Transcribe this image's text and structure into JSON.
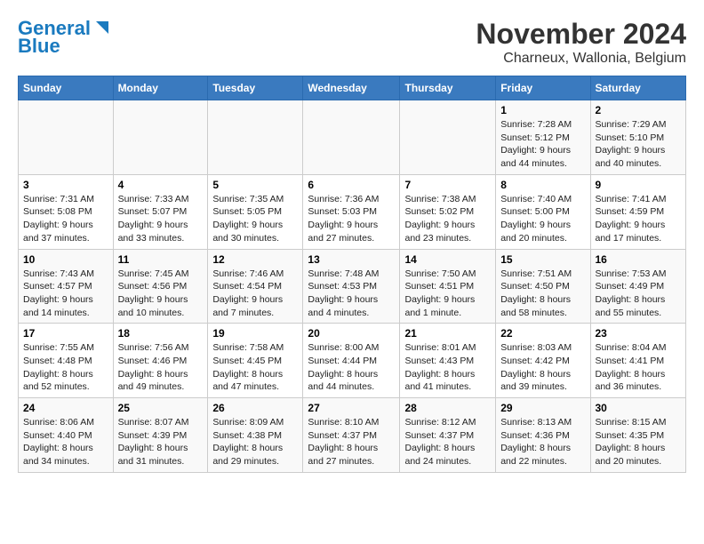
{
  "logo": {
    "line1": "General",
    "line2": "Blue"
  },
  "title": "November 2024",
  "subtitle": "Charneux, Wallonia, Belgium",
  "days_of_week": [
    "Sunday",
    "Monday",
    "Tuesday",
    "Wednesday",
    "Thursday",
    "Friday",
    "Saturday"
  ],
  "weeks": [
    [
      {
        "day": "",
        "detail": ""
      },
      {
        "day": "",
        "detail": ""
      },
      {
        "day": "",
        "detail": ""
      },
      {
        "day": "",
        "detail": ""
      },
      {
        "day": "",
        "detail": ""
      },
      {
        "day": "1",
        "detail": "Sunrise: 7:28 AM\nSunset: 5:12 PM\nDaylight: 9 hours and 44 minutes."
      },
      {
        "day": "2",
        "detail": "Sunrise: 7:29 AM\nSunset: 5:10 PM\nDaylight: 9 hours and 40 minutes."
      }
    ],
    [
      {
        "day": "3",
        "detail": "Sunrise: 7:31 AM\nSunset: 5:08 PM\nDaylight: 9 hours and 37 minutes."
      },
      {
        "day": "4",
        "detail": "Sunrise: 7:33 AM\nSunset: 5:07 PM\nDaylight: 9 hours and 33 minutes."
      },
      {
        "day": "5",
        "detail": "Sunrise: 7:35 AM\nSunset: 5:05 PM\nDaylight: 9 hours and 30 minutes."
      },
      {
        "day": "6",
        "detail": "Sunrise: 7:36 AM\nSunset: 5:03 PM\nDaylight: 9 hours and 27 minutes."
      },
      {
        "day": "7",
        "detail": "Sunrise: 7:38 AM\nSunset: 5:02 PM\nDaylight: 9 hours and 23 minutes."
      },
      {
        "day": "8",
        "detail": "Sunrise: 7:40 AM\nSunset: 5:00 PM\nDaylight: 9 hours and 20 minutes."
      },
      {
        "day": "9",
        "detail": "Sunrise: 7:41 AM\nSunset: 4:59 PM\nDaylight: 9 hours and 17 minutes."
      }
    ],
    [
      {
        "day": "10",
        "detail": "Sunrise: 7:43 AM\nSunset: 4:57 PM\nDaylight: 9 hours and 14 minutes."
      },
      {
        "day": "11",
        "detail": "Sunrise: 7:45 AM\nSunset: 4:56 PM\nDaylight: 9 hours and 10 minutes."
      },
      {
        "day": "12",
        "detail": "Sunrise: 7:46 AM\nSunset: 4:54 PM\nDaylight: 9 hours and 7 minutes."
      },
      {
        "day": "13",
        "detail": "Sunrise: 7:48 AM\nSunset: 4:53 PM\nDaylight: 9 hours and 4 minutes."
      },
      {
        "day": "14",
        "detail": "Sunrise: 7:50 AM\nSunset: 4:51 PM\nDaylight: 9 hours and 1 minute."
      },
      {
        "day": "15",
        "detail": "Sunrise: 7:51 AM\nSunset: 4:50 PM\nDaylight: 8 hours and 58 minutes."
      },
      {
        "day": "16",
        "detail": "Sunrise: 7:53 AM\nSunset: 4:49 PM\nDaylight: 8 hours and 55 minutes."
      }
    ],
    [
      {
        "day": "17",
        "detail": "Sunrise: 7:55 AM\nSunset: 4:48 PM\nDaylight: 8 hours and 52 minutes."
      },
      {
        "day": "18",
        "detail": "Sunrise: 7:56 AM\nSunset: 4:46 PM\nDaylight: 8 hours and 49 minutes."
      },
      {
        "day": "19",
        "detail": "Sunrise: 7:58 AM\nSunset: 4:45 PM\nDaylight: 8 hours and 47 minutes."
      },
      {
        "day": "20",
        "detail": "Sunrise: 8:00 AM\nSunset: 4:44 PM\nDaylight: 8 hours and 44 minutes."
      },
      {
        "day": "21",
        "detail": "Sunrise: 8:01 AM\nSunset: 4:43 PM\nDaylight: 8 hours and 41 minutes."
      },
      {
        "day": "22",
        "detail": "Sunrise: 8:03 AM\nSunset: 4:42 PM\nDaylight: 8 hours and 39 minutes."
      },
      {
        "day": "23",
        "detail": "Sunrise: 8:04 AM\nSunset: 4:41 PM\nDaylight: 8 hours and 36 minutes."
      }
    ],
    [
      {
        "day": "24",
        "detail": "Sunrise: 8:06 AM\nSunset: 4:40 PM\nDaylight: 8 hours and 34 minutes."
      },
      {
        "day": "25",
        "detail": "Sunrise: 8:07 AM\nSunset: 4:39 PM\nDaylight: 8 hours and 31 minutes."
      },
      {
        "day": "26",
        "detail": "Sunrise: 8:09 AM\nSunset: 4:38 PM\nDaylight: 8 hours and 29 minutes."
      },
      {
        "day": "27",
        "detail": "Sunrise: 8:10 AM\nSunset: 4:37 PM\nDaylight: 8 hours and 27 minutes."
      },
      {
        "day": "28",
        "detail": "Sunrise: 8:12 AM\nSunset: 4:37 PM\nDaylight: 8 hours and 24 minutes."
      },
      {
        "day": "29",
        "detail": "Sunrise: 8:13 AM\nSunset: 4:36 PM\nDaylight: 8 hours and 22 minutes."
      },
      {
        "day": "30",
        "detail": "Sunrise: 8:15 AM\nSunset: 4:35 PM\nDaylight: 8 hours and 20 minutes."
      }
    ]
  ]
}
